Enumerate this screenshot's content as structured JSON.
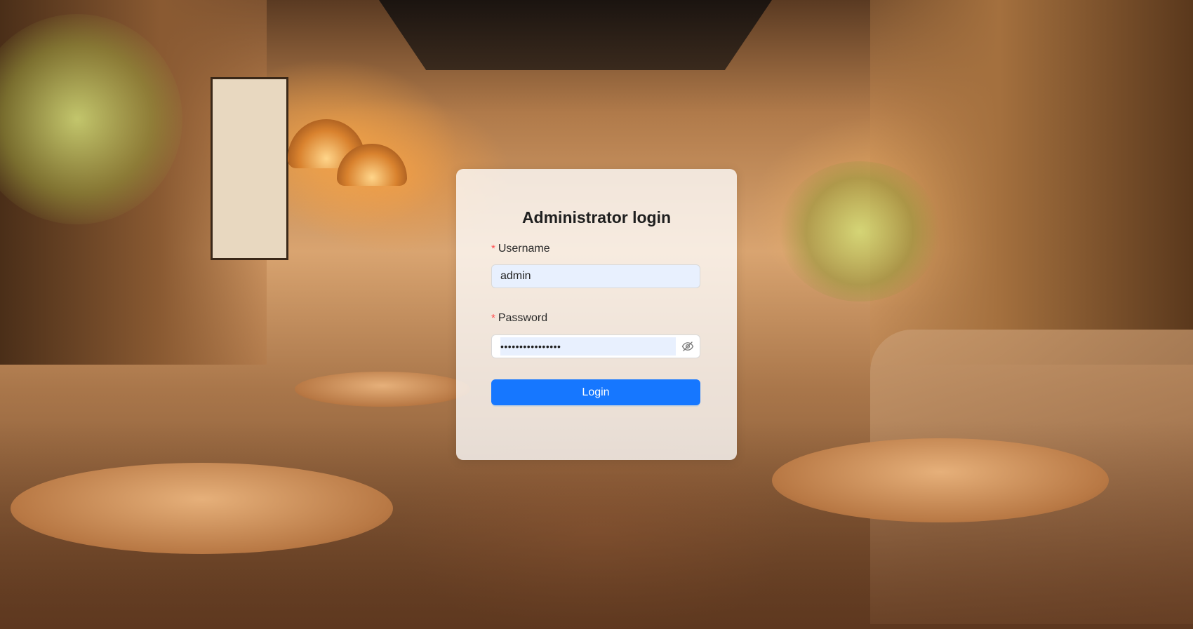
{
  "login": {
    "title": "Administrator login",
    "username_label": "Username",
    "username_value": "admin",
    "password_label": "Password",
    "password_value": "••••••••••••••••",
    "submit_label": "Login",
    "required_marker": "*",
    "password_toggle_icon": "eye-invisible-icon"
  },
  "colors": {
    "primary": "#1677ff",
    "required": "#ff4d4f",
    "input_autofill_bg": "#e8f0fe"
  }
}
